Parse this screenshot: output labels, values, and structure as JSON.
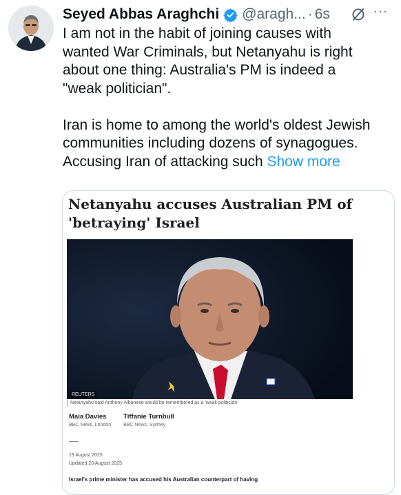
{
  "tweet": {
    "author_name": "Seyed Abbas Araghchi",
    "handle": "@aragh...",
    "separator": "·",
    "time": "6s",
    "more": "···",
    "text_lines_1": [
      "I am not in the habit of joining causes with",
      "wanted War Criminals, but Netanyahu is right",
      "about one thing: Australia's PM is indeed a",
      "\"weak politician\"."
    ],
    "text_lines_2": [
      "Iran is home to among the world's oldest Jewish",
      "communities including dozens of synagogues."
    ],
    "text_line_last": "Accusing Iran of attacking such ",
    "show_more": "Show more"
  },
  "card": {
    "headline_line1": "Netanyahu accuses Australian PM of",
    "headline_line2": "'betraying' Israel",
    "photo_credit": "REUTERS",
    "caption": "Netanyahu said Anthony Albanese would be remembered as a 'weak politician'",
    "authors": [
      {
        "name": "Maia Davies",
        "org": "BBC News, London"
      },
      {
        "name": "Tiffanie Turnbull",
        "org": "BBC News, Sydney"
      }
    ],
    "published": "19 August 2025",
    "updated": "Updated 20 August 2025",
    "lede": "Israel's prime minister has accused his Australian counterpart of having"
  },
  "colors": {
    "link": "#1d9bf0",
    "verified": "#1d9bf0",
    "muted": "#536471",
    "border": "#cfd9de"
  }
}
